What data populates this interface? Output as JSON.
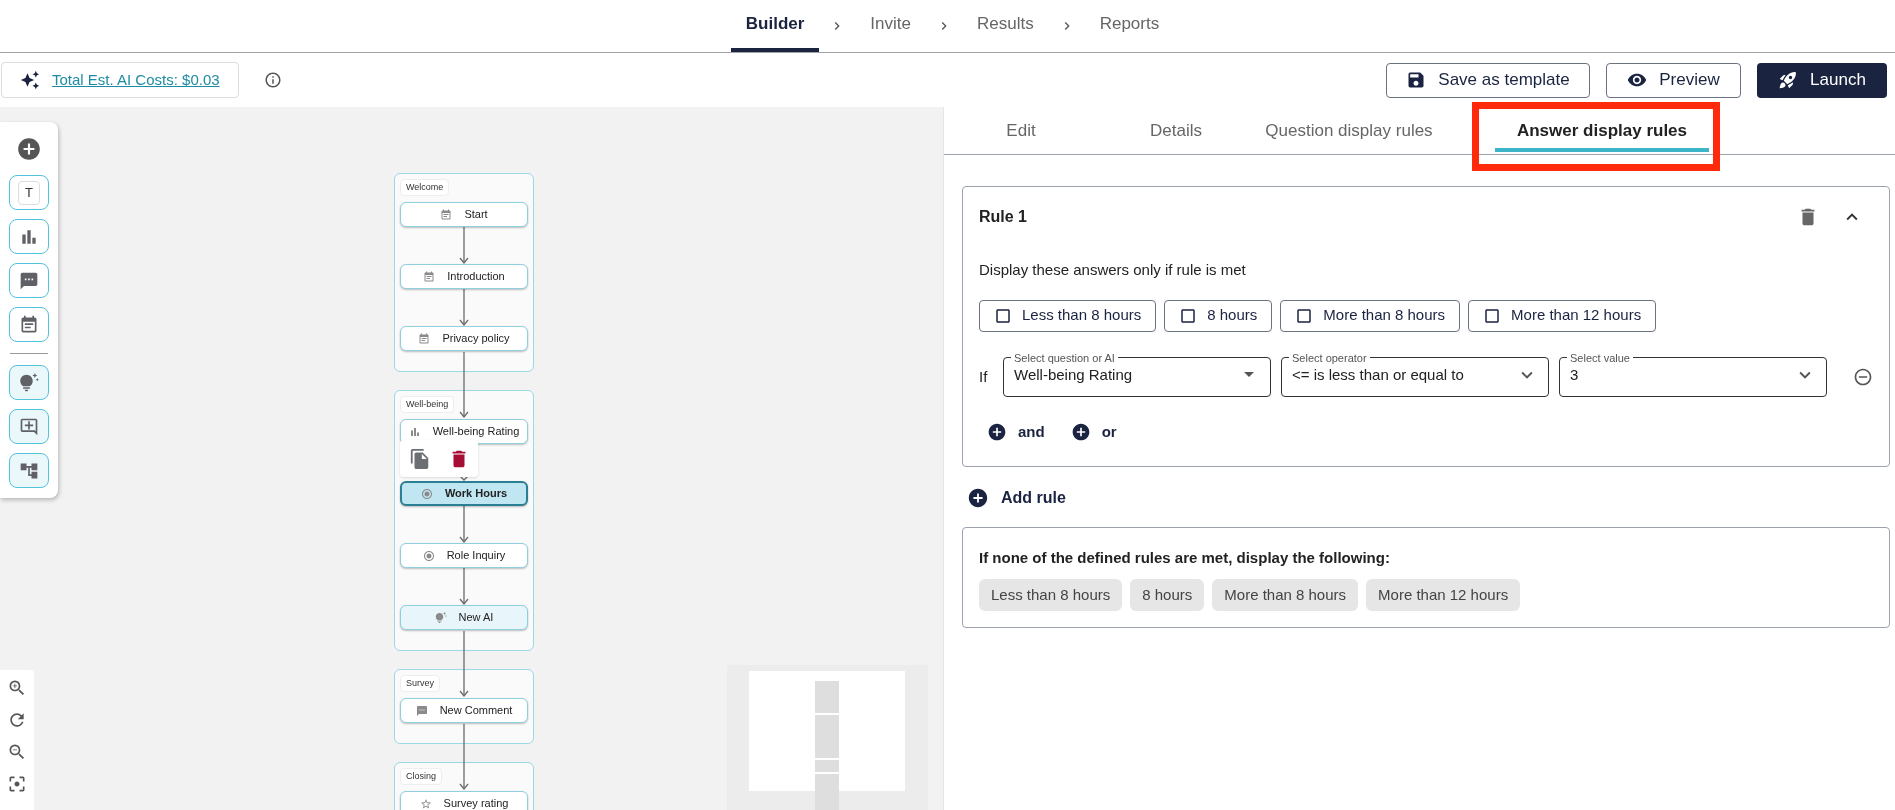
{
  "steps": [
    {
      "label": "Builder",
      "selected": true
    },
    {
      "label": "Invite",
      "selected": false
    },
    {
      "label": "Results",
      "selected": false
    },
    {
      "label": "Reports",
      "selected": false
    }
  ],
  "toolbar": {
    "ai_costs": "Total Est. AI Costs: $0.03",
    "buttons": [
      {
        "label": "Save as template",
        "kind": "save"
      },
      {
        "label": "Preview",
        "kind": "preview"
      },
      {
        "label": "Launch",
        "kind": "launch"
      }
    ]
  },
  "tools": [
    {
      "kind": "add"
    },
    {
      "kind": "text",
      "label": "T"
    },
    {
      "kind": "rating"
    },
    {
      "kind": "comment"
    },
    {
      "kind": "page"
    },
    {
      "kind": "divider"
    },
    {
      "kind": "ai"
    },
    {
      "kind": "chat"
    },
    {
      "kind": "logic"
    }
  ],
  "flow": {
    "groups": [
      {
        "title": "Welcome",
        "nodes": [
          {
            "label": "Start",
            "kind": "page",
            "selected": false,
            "menu_open": false
          },
          {
            "label": "Introduction",
            "kind": "page",
            "selected": false,
            "menu_open": false
          },
          {
            "label": "Privacy policy",
            "kind": "page",
            "selected": false,
            "menu_open": false
          }
        ]
      },
      {
        "title": "Well-being",
        "nodes": [
          {
            "label": "Well-being Rating",
            "kind": "rating",
            "selected": false,
            "menu_open": false
          },
          {
            "label": "Work Hours",
            "kind": "choice",
            "selected": true,
            "menu_open": true
          },
          {
            "label": "Role Inquiry",
            "kind": "choice",
            "selected": false,
            "menu_open": false
          },
          {
            "label": "New AI",
            "kind": "ai",
            "selected": false,
            "menu_open": false
          }
        ]
      },
      {
        "title": "Survey",
        "nodes": [
          {
            "label": "New Comment",
            "kind": "comment",
            "selected": false,
            "menu_open": false
          }
        ]
      },
      {
        "title": "Closing",
        "nodes": [
          {
            "label": "Survey rating",
            "kind": "star",
            "selected": false,
            "menu_open": false
          }
        ]
      }
    ]
  },
  "panel": {
    "tabs": [
      {
        "label": "Edit",
        "selected": false,
        "highlighted": false
      },
      {
        "label": "Details",
        "selected": false,
        "highlighted": false
      },
      {
        "label": "Question display rules",
        "selected": false,
        "highlighted": false
      },
      {
        "label": "Answer display rules",
        "selected": true,
        "highlighted": true
      }
    ],
    "rules": [
      {
        "title": "Rule 1",
        "expanded": true,
        "intro": "Display these answers only if rule is met",
        "answers": [
          {
            "label": "Less than 8 hours",
            "checked": false
          },
          {
            "label": "8 hours",
            "checked": false
          },
          {
            "label": "More than 8 hours",
            "checked": false
          },
          {
            "label": "More than 12 hours",
            "checked": false
          }
        ],
        "conditions": [
          {
            "prefix": "If",
            "fields": [
              {
                "label": "Select question or AI",
                "value": "Well-being Rating",
                "kind": "autocomplete"
              },
              {
                "label": "Select operator",
                "value": "<= is less than or equal to",
                "kind": "select"
              },
              {
                "label": "Select value",
                "value": "3",
                "kind": "select"
              }
            ]
          }
        ],
        "connectors": [
          "and",
          "or"
        ]
      }
    ],
    "add_rule": "Add rule",
    "fallback": {
      "title": "If none of the defined rules are met, display the following:",
      "answers": [
        "Less than 8 hours",
        "8 hours",
        "More than 8 hours",
        "More than 12 hours"
      ]
    }
  }
}
